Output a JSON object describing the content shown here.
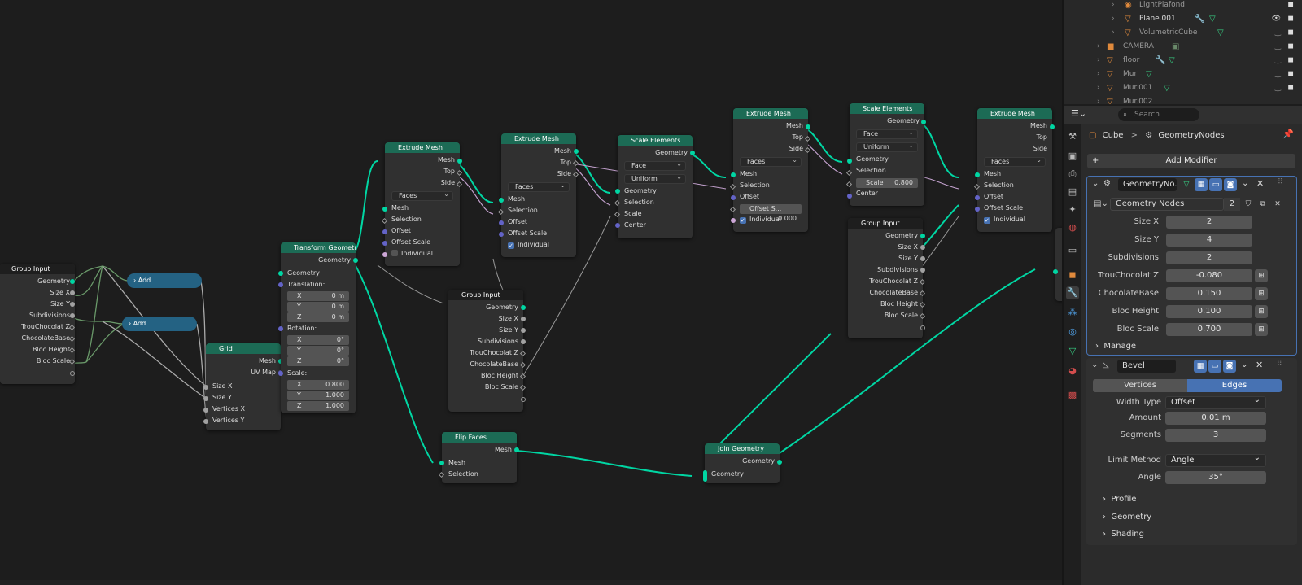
{
  "nodes": {
    "group_input_1": {
      "title": "Group Input",
      "outputs": [
        "Geometry",
        "Size X",
        "Size Y",
        "Subdivisions",
        "TrouChocolat Z",
        "ChocolateBase",
        "Bloc Height",
        "Bloc Scale"
      ]
    },
    "add_1": {
      "title": "Add"
    },
    "add_2": {
      "title": "Add"
    },
    "grid": {
      "title": "Grid",
      "outputs": [
        "Mesh",
        "UV Map"
      ],
      "inputs": [
        "Size X",
        "Size Y",
        "Vertices X",
        "Vertices Y"
      ]
    },
    "transform": {
      "title": "Transform Geometry",
      "output": "Geometry",
      "input": "Geometry",
      "translation_label": "Translation:",
      "translation": [
        {
          "k": "X",
          "v": "0 m"
        },
        {
          "k": "Y",
          "v": "0 m"
        },
        {
          "k": "Z",
          "v": "0 m"
        }
      ],
      "rotation_label": "Rotation:",
      "rotation": [
        {
          "k": "X",
          "v": "0°"
        },
        {
          "k": "Y",
          "v": "0°"
        },
        {
          "k": "Z",
          "v": "0°"
        }
      ],
      "scale_label": "Scale:",
      "scale": [
        {
          "k": "X",
          "v": "0.800"
        },
        {
          "k": "Y",
          "v": "1.000"
        },
        {
          "k": "Z",
          "v": "1.000"
        }
      ]
    },
    "extrude_1": {
      "title": "Extrude Mesh",
      "outputs": [
        "Mesh",
        "Top",
        "Side"
      ],
      "mode": "Faces",
      "inputs": [
        "Mesh",
        "Selection",
        "Offset",
        "Offset Scale"
      ],
      "individual": "Individual"
    },
    "extrude_2": {
      "title": "Extrude Mesh",
      "outputs": [
        "Mesh",
        "Top",
        "Side"
      ],
      "mode": "Faces",
      "inputs": [
        "Mesh",
        "Selection",
        "Offset",
        "Offset Scale"
      ],
      "individual": "Individual"
    },
    "group_input_2": {
      "title": "Group Input",
      "outputs": [
        "Geometry",
        "Size X",
        "Size Y",
        "Subdivisions",
        "TrouChocolat Z",
        "ChocolateBase",
        "Bloc Height",
        "Bloc Scale"
      ]
    },
    "scale_1": {
      "title": "Scale Elements",
      "output": "Geometry",
      "domain": "Face",
      "mode": "Uniform",
      "inputs": [
        "Geometry",
        "Selection",
        "Scale",
        "Center"
      ]
    },
    "extrude_3": {
      "title": "Extrude Mesh",
      "outputs": [
        "Mesh",
        "Top",
        "Side"
      ],
      "mode": "Faces",
      "inputs": [
        "Mesh",
        "Selection",
        "Offset"
      ],
      "offset_scale_label": "Offset S...",
      "offset_scale_value": "0.000",
      "individual": "Individual"
    },
    "scale_2": {
      "title": "Scale Elements",
      "output": "Geometry",
      "domain": "Face",
      "mode": "Uniform",
      "inputs": [
        "Geometry",
        "Selection"
      ],
      "scale_label": "Scale",
      "scale_value": "0.800",
      "center": "Center"
    },
    "group_input_3": {
      "title": "Group Input",
      "outputs": [
        "Geometry",
        "Size X",
        "Size Y",
        "Subdivisions",
        "TrouChocolat Z",
        "ChocolateBase",
        "Bloc Height",
        "Bloc Scale"
      ]
    },
    "extrude_4": {
      "title": "Extrude Mesh",
      "outputs": [
        "Mesh",
        "Top",
        "Side"
      ],
      "mode": "Faces",
      "inputs": [
        "Mesh",
        "Selection",
        "Offset",
        "Offset Scale"
      ],
      "individual": "Individual"
    },
    "flip": {
      "title": "Flip Faces",
      "output": "Mesh",
      "inputs": [
        "Mesh",
        "Selection"
      ]
    },
    "join": {
      "title": "Join Geometry",
      "output": "Geometry",
      "input": "Geometry"
    }
  },
  "outliner": {
    "rows": [
      {
        "name": "LightPlafond",
        "kind": "light"
      },
      {
        "name": "Plane.001",
        "kind": "mesh"
      },
      {
        "name": "VolumetricCube",
        "kind": "mesh"
      },
      {
        "name": "CAMERA",
        "kind": "collection"
      },
      {
        "name": "floor",
        "kind": "mesh"
      },
      {
        "name": "Mur",
        "kind": "mesh"
      },
      {
        "name": "Mur.001",
        "kind": "mesh"
      },
      {
        "name": "Mur.002",
        "kind": "mesh"
      }
    ]
  },
  "properties": {
    "search_placeholder": "Search",
    "breadcrumb": {
      "object": "Cube",
      "sep": ">",
      "modifier": "GeometryNodes"
    },
    "add_modifier": "Add Modifier",
    "gn_modifier": {
      "name": "GeometryNo...",
      "node_group": "Geometry Nodes",
      "users": "2",
      "params": [
        {
          "label": "Size X",
          "value": "2"
        },
        {
          "label": "Size Y",
          "value": "4"
        },
        {
          "label": "Subdivisions",
          "value": "2"
        },
        {
          "label": "TrouChocolat Z",
          "value": "-0.080"
        },
        {
          "label": "ChocolateBase",
          "value": "0.150"
        },
        {
          "label": "Bloc Height",
          "value": "0.100"
        },
        {
          "label": "Bloc Scale",
          "value": "0.700"
        }
      ],
      "manage": "Manage"
    },
    "bevel": {
      "name": "Bevel",
      "tab_vertices": "Vertices",
      "tab_edges": "Edges",
      "width_type_label": "Width Type",
      "width_type": "Offset",
      "amount_label": "Amount",
      "amount": "0.01 m",
      "segments_label": "Segments",
      "segments": "3",
      "limit_method_label": "Limit Method",
      "limit_method": "Angle",
      "angle_label": "Angle",
      "angle": "35°",
      "subpanels": [
        "Profile",
        "Geometry",
        "Shading"
      ]
    }
  },
  "colors": {
    "geometry_socket": "#00d6a3",
    "geometry_header": "#1c6b55",
    "math_node": "#246283",
    "active_blue": "#4772b3"
  }
}
